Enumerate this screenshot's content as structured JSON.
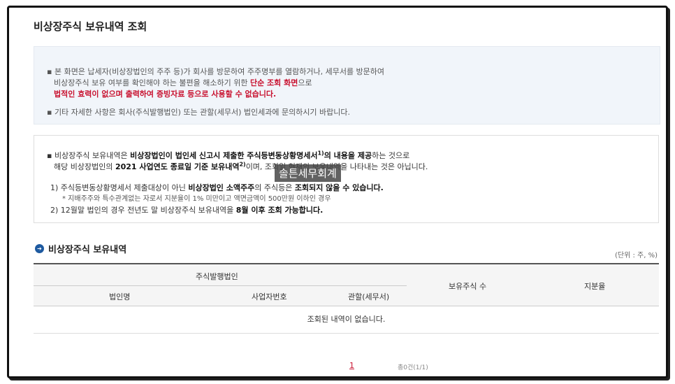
{
  "page": {
    "title": "비상장주식 보유내역 조회"
  },
  "notice": {
    "line1": "본 화면은 납세자(비상장법인의 주주 등)가 회사를 방문하여 주주명부를 열람하거나, 세무서를 방문하여",
    "line2a": "비상장주식 보유 여부를 확인해야 하는 불편을 해소하기 위한 ",
    "line2b": "단순 조회 화면",
    "line2c": "으로",
    "line3": "법적인 효력이 없으며 출력하여 증빙자료 등으로 사용할 수 없습니다.",
    "line4": "기타 자세한 사항은 회사(주식발행법인) 또는 관할(세무서) 법인세과에 문의하시기 바랍니다."
  },
  "info": {
    "l1a": "비상장주식 보유내역은 ",
    "l1b": "비상장법인이 법인세 신고시 제출한 주식등변동상황명세서",
    "l1sup": "1)",
    "l1c": "의 내용을 제공",
    "l1d": "하는 것으로",
    "l2a": "해당 비상장법인의 ",
    "l2b": "2021 사업연도 종료일 기준 보유내역",
    "l2sup": "2)",
    "l2c": "이며, 조회일 현재의 보유내역을 나타내는 것은 아닙니다.",
    "n1a": "1) 주식등변동상황명세서 제출대상이 아닌 ",
    "n1b": "비상장법인 소액주주",
    "n1c": "의 주식등은 ",
    "n1d": "조회되지 않을 수 있습니다.",
    "n1sub": "* 지배주주와 특수관계없는 자로서 지분율이 1% 미만이고 액면금액이 500만원 이하인 경우",
    "n2a": "2) 12월말 법인의 경우 전년도 말 비상장주식 보유내역을 ",
    "n2b": "8월 이후 조회 가능합니다."
  },
  "watermark": "솔튼세무회계",
  "section": {
    "title": "비상장주식 보유내역",
    "unit": "(단위 : 주, %)"
  },
  "table": {
    "group_header": "주식발행법인",
    "headers": [
      "법인명",
      "사업자번호",
      "관할(세무서)",
      "보유주식 수",
      "지분율"
    ],
    "empty_message": "조회된 내역이 없습니다."
  },
  "pagination": {
    "current": "1",
    "summary": "총0건(1/1)"
  }
}
